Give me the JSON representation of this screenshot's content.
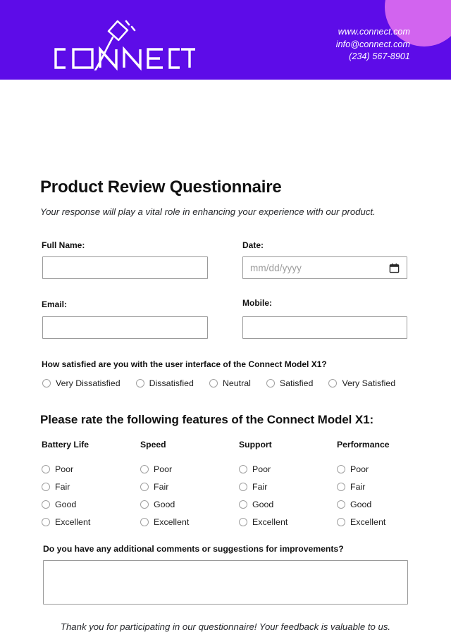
{
  "header": {
    "brand_name": "CONNECT",
    "logo_icon": "plug-icon",
    "background_color": "#5D0CE8",
    "accent_circle_color": "#D264EF",
    "contact": {
      "website": "www.connect.com",
      "email": "info@connect.com",
      "phone": "(234) 567-8901"
    }
  },
  "form": {
    "title": "Product Review Questionnaire",
    "subtitle": "Your response will play a vital role in enhancing your experience with our product.",
    "fields": {
      "full_name": {
        "label": "Full Name:",
        "value": "",
        "placeholder": ""
      },
      "date": {
        "label": "Date:",
        "value": "",
        "placeholder": "mm/dd/yyyy",
        "icon": "calendar-icon"
      },
      "email": {
        "label": "Email:",
        "value": "",
        "placeholder": ""
      },
      "mobile": {
        "label": "Mobile:",
        "value": "",
        "placeholder": ""
      }
    },
    "satisfaction": {
      "question": "How satisfied are you with the user interface of the Connect Model X1?",
      "options": [
        "Very Dissatisfied",
        "Dissatisfied",
        "Neutral",
        "Satisfied",
        "Very Satisfied"
      ]
    },
    "ratings": {
      "section_title": "Please rate the following features of the Connect Model X1:",
      "scale": [
        "Poor",
        "Fair",
        "Good",
        "Excellent"
      ],
      "columns": [
        {
          "label": "Battery Life"
        },
        {
          "label": "Speed"
        },
        {
          "label": "Support"
        },
        {
          "label": "Performance"
        }
      ]
    },
    "comments": {
      "label": "Do you have any additional comments or suggestions for improvements?",
      "value": "",
      "placeholder": ""
    },
    "footer_note": "Thank you for participating in our questionnaire! Your feedback is valuable to us."
  }
}
